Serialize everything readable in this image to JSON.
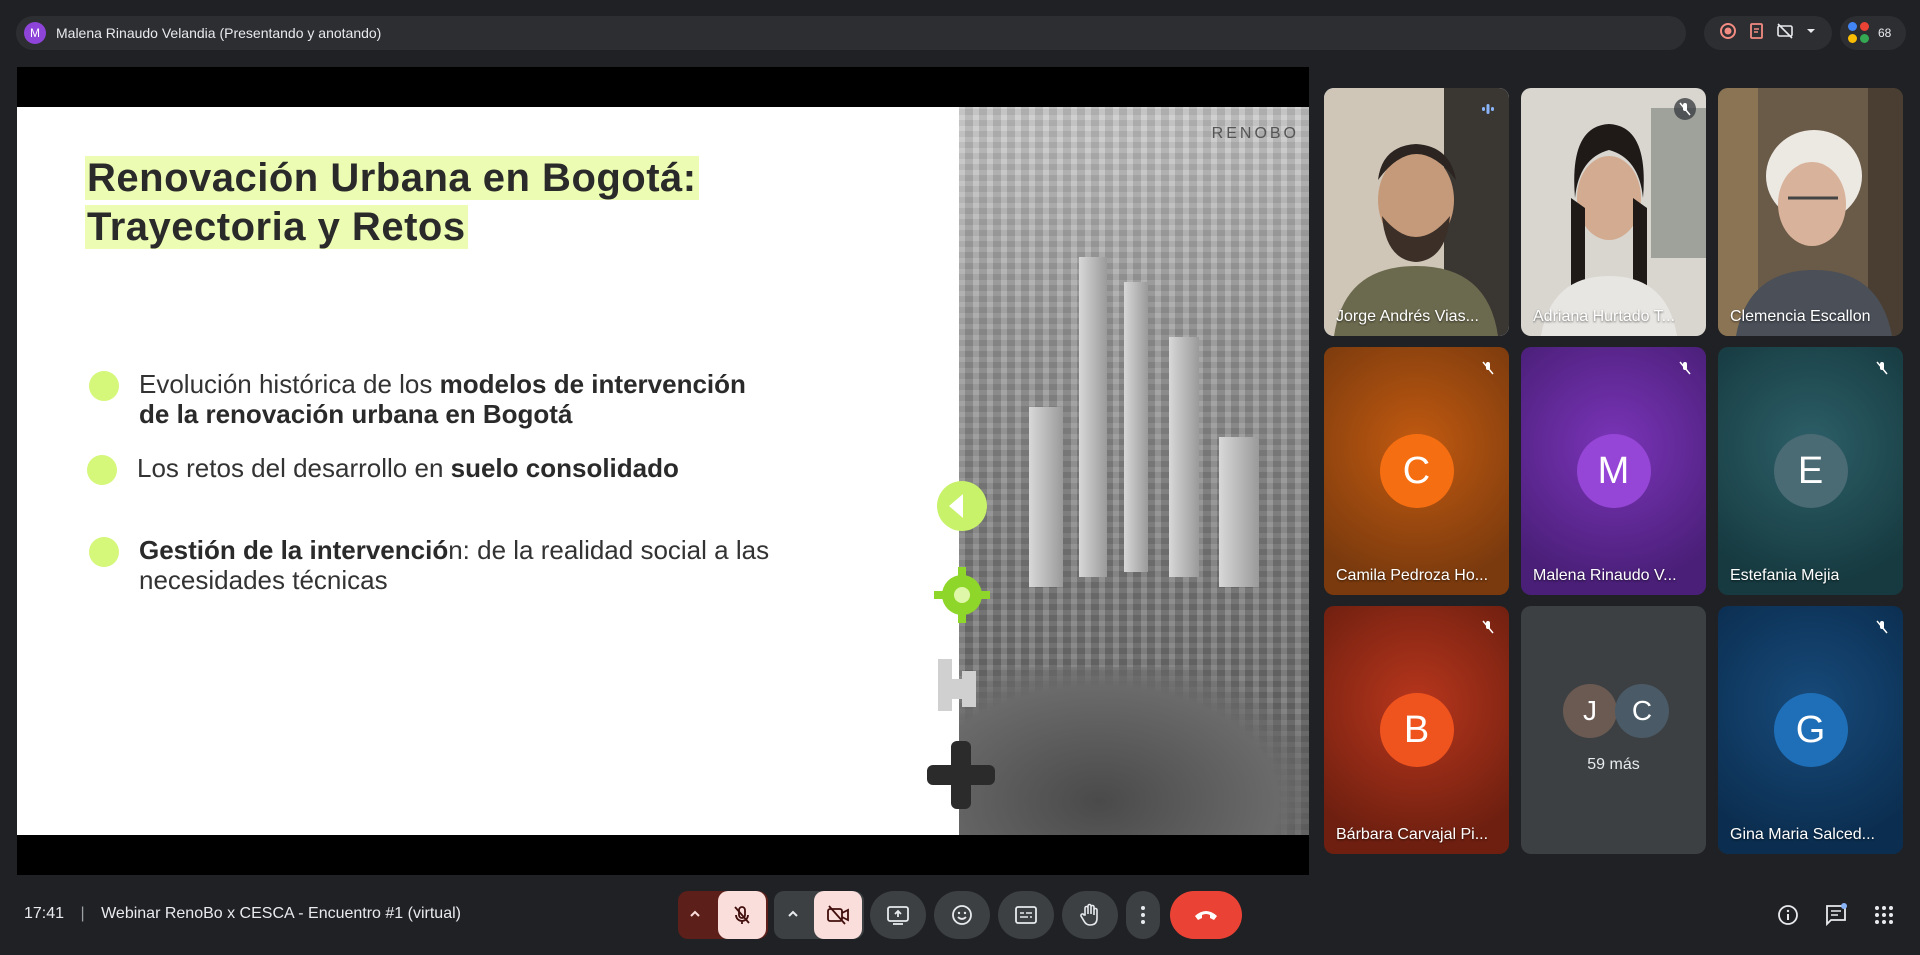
{
  "presenter": {
    "avatar_letter": "M",
    "label": "Malena Rinaudo Velandia (Presentando y anotando)"
  },
  "participant_count": "68",
  "slide": {
    "title_line1": "Renovación Urbana en Bogotá:",
    "title_line2": "Trayectoria y Retos",
    "logo": "RENOBO",
    "bullets": [
      {
        "normal": "Evolución histórica de los ",
        "bold": "modelos de intervención de la renovación urbana en Bogotá",
        "tail": ""
      },
      {
        "normal": "Los retos del desarrollo en ",
        "bold": "suelo consolidado",
        "tail": ""
      },
      {
        "normal": "",
        "bold": "Gestión de la intervenció",
        "tail": "n: de la realidad social a las necesidades técnicas"
      }
    ]
  },
  "tiles": [
    {
      "name": "Jorge Andrés Vias...",
      "kind": "video",
      "speaking": true
    },
    {
      "name": "Adriana Hurtado T...",
      "kind": "video",
      "muted": true
    },
    {
      "name": "Clemencia Escallon",
      "kind": "video"
    },
    {
      "name": "Camila Pedroza Ho...",
      "letter": "C",
      "muted": true
    },
    {
      "name": "Malena Rinaudo V...",
      "letter": "M",
      "muted": true
    },
    {
      "name": "Estefania Mejia",
      "letter": "E",
      "muted": true
    },
    {
      "name": "Bárbara Carvajal Pi...",
      "letter": "B",
      "muted": true
    },
    {
      "name": "59 más",
      "letters": [
        "J",
        "C"
      ]
    },
    {
      "name": "Gina Maria Salced...",
      "letter": "G",
      "muted": true
    }
  ],
  "bottom": {
    "time": "17:41",
    "separator": "|",
    "meeting_title": "Webinar RenoBo x CESCA - Encuentro #1 (virtual)"
  },
  "colors": {
    "accent_green": "#d5f77a",
    "highlight": "#ecfcb3",
    "end_call": "#ea4335",
    "speaking_ring": "#8ab4f8"
  }
}
